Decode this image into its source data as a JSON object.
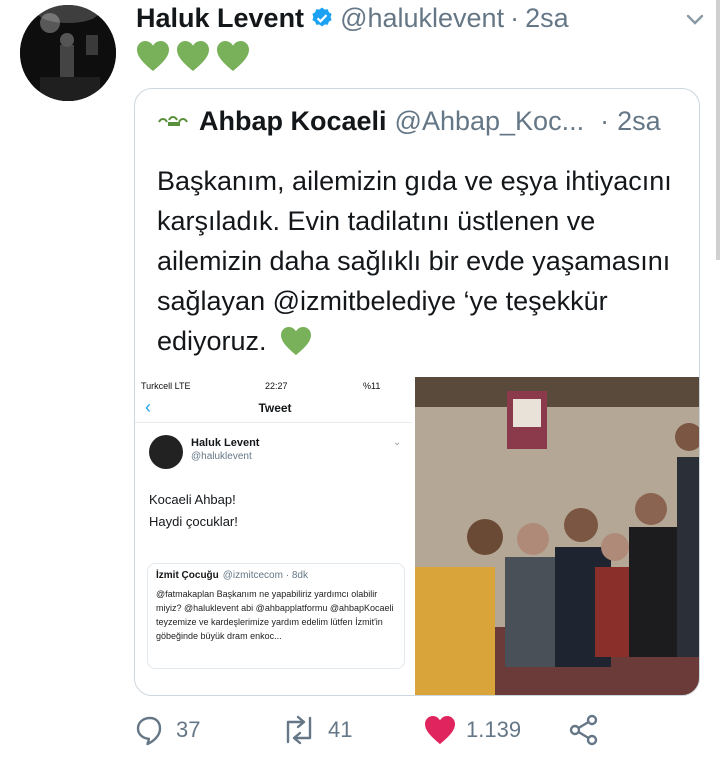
{
  "tweet": {
    "author_name": "Haluk Levent",
    "author_handle": "@haluklevent",
    "dot": "·",
    "time": "2sa",
    "emoji_hearts": [
      "green-heart",
      "green-heart",
      "green-heart"
    ]
  },
  "quote": {
    "author_name": "Ahbap Kocaeli",
    "author_handle": "@Ahbap_Koc...",
    "dot": "·",
    "time": "2sa",
    "text": "Başkanım, ailemizin gıda ve eşya ihtiyacını karşıladık. Evin tadilatını üstlenen ve ailemizin daha sağlıklı bir evde yaşamasını sağlayan @izmitbelediye ‘ye teşekkür ediyoruz."
  },
  "screenshot": {
    "carrier": "Turkcell LTE",
    "clock": "22:27",
    "battery": "%11",
    "nav_title": "Tweet",
    "name": "Haluk Levent",
    "handle": "@haluklevent",
    "line1": "Kocaeli Ahbap!",
    "line2": "Haydi çocuklar!",
    "quoted_name": "İzmit Çocuğu",
    "quoted_meta": "@izmitcecom · 8dk",
    "quoted_text": "@fatmakaplan Başkanım ne yapabiliriz yardımcı olabilir miyiz? @haluklevent abi @ahbapplatformu @ahbapKocaeli teyzemize ve kardeşlerimize yardım edelim lütfen İzmit'in göbeğinde büyük dram enkoc..."
  },
  "actions": {
    "replies": "37",
    "retweets": "41",
    "likes": "1.139"
  },
  "colors": {
    "link_blue": "#1da1f2",
    "green_heart": "#78b159",
    "like_red": "#e0245e",
    "muted": "#657786"
  }
}
